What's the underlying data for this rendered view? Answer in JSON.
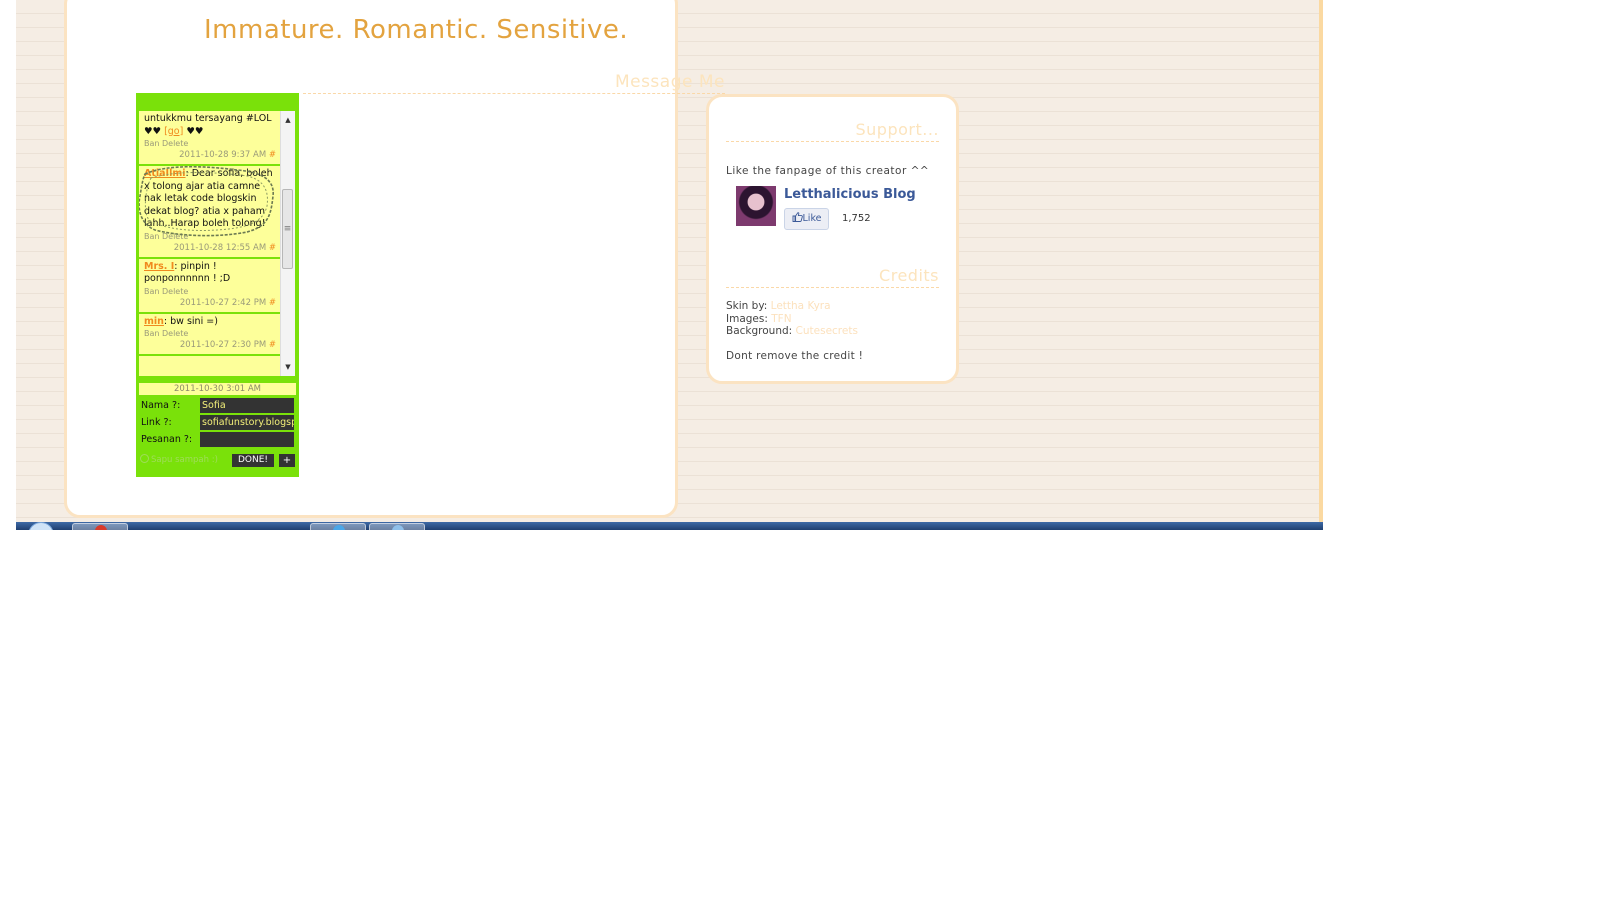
{
  "blog": {
    "header_title": "Immature. Romantic.  Sensitive.",
    "message_heading": "Message Me"
  },
  "shoutbox": {
    "title": "",
    "messages": [
      {
        "author": "",
        "text": "untukkmu tersayang #LOL ♥♥ ",
        "link": "[go]",
        "text_after": " ♥♥",
        "actions": "Ban Delete",
        "time": "2011-10-28 9:37 AM",
        "hash": "#"
      },
      {
        "author": "AtiaIlmi",
        "text": ": Dear sofia, boleh x tolong ajar atia camne nak letak code blogskin dekat blog? atia x paham lahh..Harap boleh tolong!",
        "actions": "Ban Delete",
        "time": "2011-10-28 12:55 AM",
        "hash": "#"
      },
      {
        "author": "Mrs. I",
        "text": ": pinpin ! ponponnnnnn ! ;D",
        "actions": "Ban Delete",
        "time": "2011-10-27 2:42 PM",
        "hash": "#"
      },
      {
        "author": "min",
        "text": ": bw sini =)",
        "actions": "Ban Delete",
        "time": "2011-10-27 2:30 PM",
        "hash": "#"
      }
    ],
    "current_time": "2011-10-30 3:01 AM",
    "fields": {
      "name_label": "Nama ?:",
      "name_value": "Sofia",
      "link_label": "Link ?:",
      "link_value": "sofiafunstory.blogspot",
      "message_label": "Pesanan ?:",
      "message_value": ""
    },
    "clean_label": "Sapu sampah :)",
    "done_label": "DONE!",
    "plus_label": "+"
  },
  "sidebar": {
    "support_heading": "Support...",
    "support_text": "Like the fanpage of this creator ^^",
    "fb_page_name": "Letthalicious Blog",
    "fb_like_label": "Like",
    "fb_like_count": "1,752",
    "credits_heading": "Credits",
    "skin_label": "Skin by:",
    "skin_value": "Lettha Kyra",
    "images_label": "Images:",
    "images_value": "TFN",
    "background_label": "Background:",
    "background_value": "Cutesecrets",
    "credit_note": "Dont remove the credit !"
  },
  "colors": {
    "shoutbox_green": "#7ae10a",
    "shoutbox_yellow": "#fdff9a",
    "accent_orange": "#e3a33f",
    "facebook_blue": "#3b5998"
  }
}
